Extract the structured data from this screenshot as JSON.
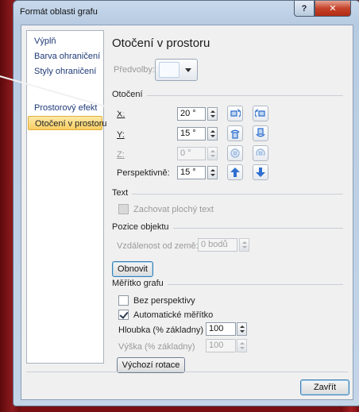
{
  "window": {
    "title": "Formát oblasti grafu",
    "help_label": "?",
    "close_label": "✕"
  },
  "nav": {
    "items": [
      {
        "label": "Výplň"
      },
      {
        "label": "Barva ohraničení"
      },
      {
        "label": "Styly ohraničení"
      },
      {
        "label": "Prostorový efekt"
      },
      {
        "label": "Otočení v prostoru"
      }
    ],
    "active_index": 4
  },
  "panel": {
    "title": "Otočení v prostoru",
    "presets_label": "Předvolby:",
    "rotation_section": "Otočení",
    "x": {
      "label": "X:",
      "value": "20 °"
    },
    "y": {
      "label": "Y:",
      "value": "15 °"
    },
    "z": {
      "label": "Z:",
      "value": "0 °"
    },
    "perspective": {
      "label": "Perspektivně:",
      "value": "15 °"
    },
    "text_section": "Text",
    "keep_flat_text": "Zachovat plochý text",
    "position_section": "Pozice objektu",
    "distance_label": "Vzdálenost od země:",
    "distance_value": "0 bodů",
    "reset_button": "Obnovit",
    "scale_section": "Měřítko grafu",
    "no_perspective": "Bez perspektivy",
    "autoscale": "Automatické měřítko",
    "depth_label": "Hloubka (% základny)",
    "depth_value": "100",
    "height_label": "Výška (% základny)",
    "height_value": "100",
    "default_rotation_button": "Výchozí rotace"
  },
  "footer": {
    "close_button": "Zavřít"
  },
  "colors": {
    "accent": "#1e3a78",
    "active_nav": "#f8cf63",
    "background": "#7a0f12",
    "icon_blue": "#2f6fd0"
  }
}
